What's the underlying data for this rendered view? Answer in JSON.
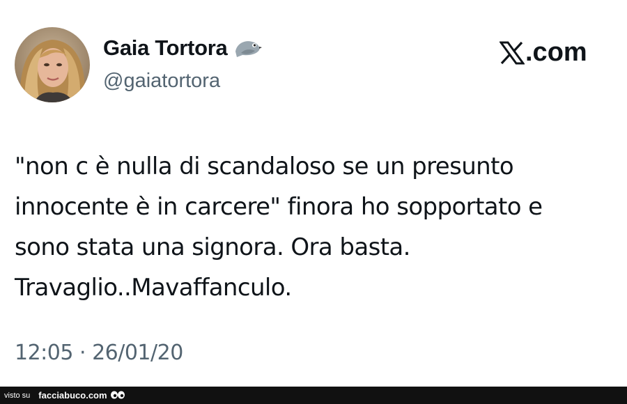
{
  "tweet": {
    "author_name": "Gaia Tortora",
    "author_badge_icon": "bird-emoji-icon",
    "author_handle": "@gaiatortora",
    "text_lines": [
      "\"non c è nulla di scandaloso se un presunto",
      "innocente è in carcere\" finora ho sopportato e",
      "sono stata una signora. Ora basta.",
      "Travaglio..Mavaffanculo."
    ],
    "timestamp": "12:05 · 26/01/20"
  },
  "brand": {
    "label": ".com",
    "logo_icon": "x-logo-icon"
  },
  "footer": {
    "prefix": "visto su",
    "site": "facciabuco.com",
    "icon": "eyes-icon"
  },
  "colors": {
    "text_primary": "#0f1419",
    "text_secondary": "#536471",
    "footer_bg": "#111111"
  }
}
